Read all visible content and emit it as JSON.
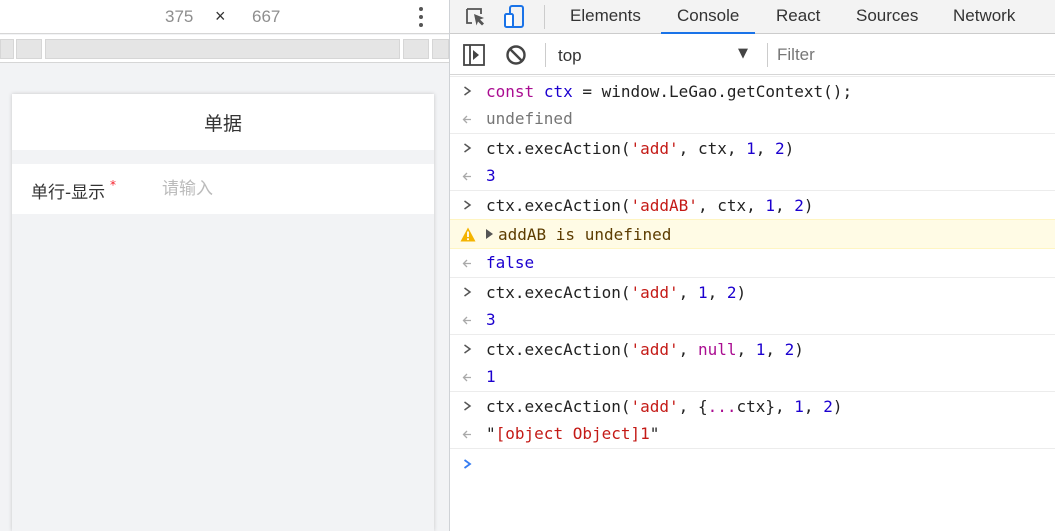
{
  "device_toolbar": {
    "width": "375",
    "times": "×",
    "height": "667"
  },
  "mobile_page": {
    "header_title": "单据",
    "row_label": "单行-显示",
    "required_mark": "*",
    "input_placeholder": "请输入"
  },
  "devtools": {
    "tabs": [
      "Elements",
      "Console",
      "React",
      "Sources",
      "Network"
    ],
    "active_tab": "Console",
    "context": "top",
    "filter_placeholder": "Filter"
  },
  "console": {
    "entries": [
      {
        "kind": "input",
        "segments": [
          {
            "t": "const",
            "c": "kw"
          },
          {
            "t": " "
          },
          {
            "t": "ctx",
            "c": "vn"
          },
          {
            "t": " = window.LeGao.getContext();"
          }
        ]
      },
      {
        "kind": "output",
        "segments": [
          {
            "t": "undefined",
            "c": "undef"
          }
        ]
      },
      {
        "kind": "input",
        "segments": [
          {
            "t": "ctx.execAction("
          },
          {
            "t": "'add'",
            "c": "str"
          },
          {
            "t": ", ctx, "
          },
          {
            "t": "1",
            "c": "num"
          },
          {
            "t": ", "
          },
          {
            "t": "2",
            "c": "num"
          },
          {
            "t": ")"
          }
        ]
      },
      {
        "kind": "output",
        "segments": [
          {
            "t": "3",
            "c": "num"
          }
        ]
      },
      {
        "kind": "input",
        "segments": [
          {
            "t": "ctx.execAction("
          },
          {
            "t": "'addAB'",
            "c": "str"
          },
          {
            "t": ", ctx, "
          },
          {
            "t": "1",
            "c": "num"
          },
          {
            "t": ", "
          },
          {
            "t": "2",
            "c": "num"
          },
          {
            "t": ")"
          }
        ]
      },
      {
        "kind": "warn",
        "segments": [
          {
            "t": "addAB is undefined"
          }
        ]
      },
      {
        "kind": "output",
        "segments": [
          {
            "t": "false",
            "c": "bool"
          }
        ]
      },
      {
        "kind": "input",
        "segments": [
          {
            "t": "ctx.execAction("
          },
          {
            "t": "'add'",
            "c": "str"
          },
          {
            "t": ", "
          },
          {
            "t": "1",
            "c": "num"
          },
          {
            "t": ", "
          },
          {
            "t": "2",
            "c": "num"
          },
          {
            "t": ")"
          }
        ]
      },
      {
        "kind": "output",
        "segments": [
          {
            "t": "3",
            "c": "num"
          }
        ]
      },
      {
        "kind": "input",
        "segments": [
          {
            "t": "ctx.execAction("
          },
          {
            "t": "'add'",
            "c": "str"
          },
          {
            "t": ", "
          },
          {
            "t": "null",
            "c": "nullv"
          },
          {
            "t": ", "
          },
          {
            "t": "1",
            "c": "num"
          },
          {
            "t": ", "
          },
          {
            "t": "2",
            "c": "num"
          },
          {
            "t": ")"
          }
        ]
      },
      {
        "kind": "output",
        "segments": [
          {
            "t": "1",
            "c": "num"
          }
        ]
      },
      {
        "kind": "input",
        "segments": [
          {
            "t": "ctx.execAction("
          },
          {
            "t": "'add'",
            "c": "str"
          },
          {
            "t": ", {"
          },
          {
            "t": "...",
            "c": "kw"
          },
          {
            "t": "ctx}, "
          },
          {
            "t": "1",
            "c": "num"
          },
          {
            "t": ", "
          },
          {
            "t": "2",
            "c": "num"
          },
          {
            "t": ")"
          }
        ]
      },
      {
        "kind": "output",
        "segments": [
          {
            "t": "\""
          },
          {
            "t": "[object Object]1",
            "c": "str"
          },
          {
            "t": "\""
          }
        ]
      }
    ]
  },
  "colors": {
    "accent": "#1a73e8",
    "prompt": "#367cf1",
    "warning_bg": "#fffbe5",
    "warning_icon": "#f4b400"
  },
  "icons": [
    "inspect-icon",
    "device-toggle-icon",
    "console-sidebar-icon",
    "clear-console-icon",
    "kebab-menu-icon",
    "warning-icon",
    "prompt-chevron-icon",
    "result-arrow-icon"
  ]
}
